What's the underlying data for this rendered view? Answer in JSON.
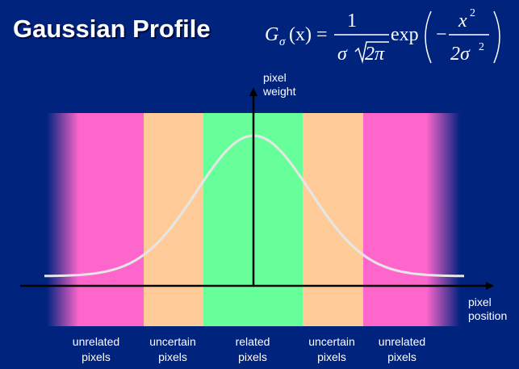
{
  "title": "Gaussian Profile",
  "formula": {
    "lhs": "G",
    "lhs_sub": "σ",
    "lhs_arg": "(x) =",
    "numerator": "1",
    "denominator_sigma": "σ",
    "denominator_root": "2π",
    "exp": "exp",
    "minus": "−",
    "inner_num": "x",
    "inner_num_sup": "2",
    "inner_den": "2σ",
    "inner_den_sup": "2"
  },
  "y_axis_label": [
    "pixel",
    "weight"
  ],
  "x_axis_label": [
    "pixel",
    "position"
  ],
  "regions": [
    {
      "label": [
        "unrelated",
        "pixels"
      ],
      "color": "#ff66cc"
    },
    {
      "label": [
        "uncertain",
        "pixels"
      ],
      "color": "#ffcc99"
    },
    {
      "label": [
        "related",
        "pixels"
      ],
      "color": "#66ff99"
    },
    {
      "label": [
        "uncertain",
        "pixels"
      ],
      "color": "#ffcc99"
    },
    {
      "label": [
        "unrelated",
        "pixels"
      ],
      "color": "#ff66cc"
    }
  ],
  "colors": {
    "background": "#00237e",
    "curve": "#e6e6e6",
    "axes": "#000000"
  }
}
